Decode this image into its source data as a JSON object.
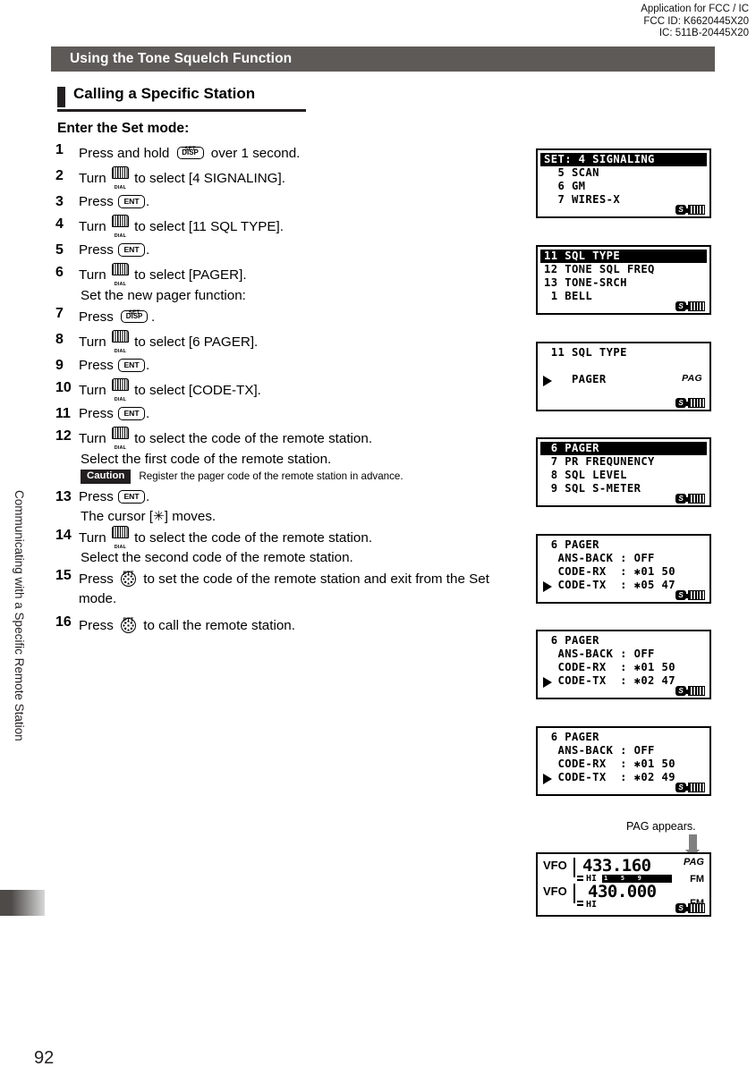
{
  "regulatory_header": {
    "line1": "Application for FCC / IC",
    "line2": "FCC ID: K6620445X20",
    "line3": "IC: 511B-20445X20"
  },
  "title_bar": {
    "text": "Using the Tone Squelch Function"
  },
  "section": {
    "title": "Calling a Specific Station"
  },
  "sidebar": {
    "vertical_label": "Communicating with a Specific Remote Station"
  },
  "page_number": "92",
  "instructions": {
    "lead": "Enter the Set mode:",
    "subheading_pager": "Set the new pager function:",
    "steps": [
      {
        "num": "1",
        "pre": "Press and hold ",
        "key": "disp",
        "post": " over 1 second."
      },
      {
        "num": "2",
        "pre": "Turn ",
        "key": "dial",
        "post": " to select [4 SIGNALING]."
      },
      {
        "num": "3",
        "pre": "Press ",
        "key": "ent",
        "post": "."
      },
      {
        "num": "4",
        "pre": "Turn ",
        "key": "dial",
        "post": " to select [11 SQL TYPE]."
      },
      {
        "num": "5",
        "pre": "Press ",
        "key": "ent",
        "post": "."
      },
      {
        "num": "6",
        "pre": "Turn ",
        "key": "dial",
        "post": " to select [PAGER]."
      },
      {
        "num": "7",
        "pre": "Press ",
        "key": "disp",
        "post": "."
      },
      {
        "num": "8",
        "pre": "Turn ",
        "key": "dial",
        "post": " to select [6 PAGER]."
      },
      {
        "num": "9",
        "pre": "Press ",
        "key": "ent",
        "post": "."
      },
      {
        "num": "10",
        "pre": "Turn ",
        "key": "dial",
        "post": " to select [CODE-TX]."
      },
      {
        "num": "11",
        "pre": "Press ",
        "key": "ent",
        "post": "."
      },
      {
        "num": "12",
        "pre": "Turn ",
        "key": "dial",
        "post": " to select the code of the remote station."
      },
      {
        "num": "13",
        "pre": "Press ",
        "key": "ent",
        "post": "."
      },
      {
        "num": "14",
        "pre": "Turn ",
        "key": "dial",
        "post": " to select the code of the remote station."
      },
      {
        "num": "15",
        "pre": "Press ",
        "key": "ptt",
        "post": " to set the code of the remote station and exit from the Set mode."
      },
      {
        "num": "16",
        "pre": "Press ",
        "key": "ptt",
        "post": " to call the remote station."
      }
    ],
    "note_first_code": "Select the first code of the remote station.",
    "note_cursor": "The cursor [✳] moves.",
    "note_second_code": "Select the second code of the remote station."
  },
  "caution": {
    "badge": "Caution",
    "text": "Register the pager code of the remote station in advance."
  },
  "keys": {
    "dial": {
      "label": "DIAL",
      "name": "dial-knob-icon"
    },
    "disp": {
      "top": "SET",
      "label": "DISP",
      "name": "disp-key-icon"
    },
    "ent": {
      "label": "ENT",
      "name": "ent-key-icon"
    },
    "ptt": {
      "top": "PTT",
      "name": "ptt-key-icon"
    }
  },
  "lcd_screens": [
    {
      "id": "set-menu-signaling",
      "header": "SET: 4 SIGNALING",
      "lines": [
        "",
        "  5 SCAN",
        "  6 GM",
        "  7 WIRES-X"
      ],
      "arrow": false,
      "pag": "",
      "status": {
        "s": "S",
        "battery": "full"
      }
    },
    {
      "id": "sql-type-menu",
      "header": "11 SQL TYPE",
      "lines": [
        "",
        "12 TONE SQL FREQ",
        "13 TONE-SRCH",
        " 1 BELL"
      ],
      "arrow": false,
      "pag": "",
      "status": {
        "s": "S",
        "battery": "full"
      }
    },
    {
      "id": "sql-type-pager-selected",
      "header": "",
      "lines": [
        " 11 SQL TYPE",
        "",
        "    PAGER",
        ""
      ],
      "arrow": true,
      "arrow_row": 3,
      "pag": "PAG",
      "status": {
        "s": "S",
        "battery": "full"
      }
    },
    {
      "id": "pager-menu",
      "header": " 6 PAGER",
      "lines": [
        "",
        " 7 PR FREQUNENCY",
        " 8 SQL LEVEL",
        " 9 SQL S-METER"
      ],
      "arrow": false,
      "pag": "",
      "status": {
        "s": "S",
        "battery": "full"
      }
    },
    {
      "id": "pager-code-tx-0547",
      "header": "",
      "lines": [
        " 6 PAGER",
        "  ANS-BACK : OFF",
        "  CODE-RX  : ✱01 50",
        "  CODE-TX  : ✱05 47"
      ],
      "arrow": true,
      "arrow_row": 4,
      "pag": "",
      "status": {
        "s": "S",
        "battery": "full"
      }
    },
    {
      "id": "pager-code-tx-0247",
      "header": "",
      "lines": [
        " 6 PAGER",
        "  ANS-BACK : OFF",
        "  CODE-RX  : ✱01 50",
        "  CODE-TX  : ✱02 47"
      ],
      "arrow": true,
      "arrow_row": 4,
      "pag": "",
      "status": {
        "s": "S",
        "battery": "full"
      }
    },
    {
      "id": "pager-code-tx-0249",
      "header": "",
      "lines": [
        " 6 PAGER",
        "  ANS-BACK : OFF",
        "  CODE-RX  : ✱01 50",
        "  CODE-TX  : ✱02 49"
      ],
      "arrow": true,
      "arrow_row": 4,
      "pag": "",
      "status": {
        "s": "S",
        "battery": "full"
      }
    }
  ],
  "pag_annotation": {
    "text": "PAG appears."
  },
  "vfo_display": {
    "row_a": {
      "label": "VFO",
      "frequency": "433.160",
      "mode": "FM",
      "power": "HI",
      "smeter": "1   5   9",
      "indicator": "PAG"
    },
    "row_b": {
      "label": "VFO",
      "frequency": "430.000",
      "mode": "FM",
      "power": "HI"
    },
    "status": {
      "s": "S",
      "battery": "full"
    }
  }
}
